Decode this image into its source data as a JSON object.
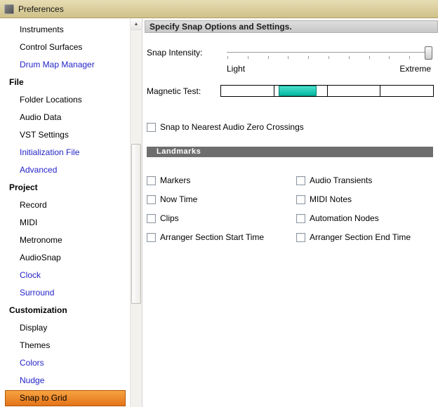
{
  "window": {
    "title": "Preferences"
  },
  "colors": {
    "titlebar-top": "#e7ddb4",
    "titlebar-bottom": "#cfc189",
    "accent-top": "#f7a341",
    "accent-bottom": "#e4731a",
    "accent-border": "#b25707",
    "link-blue": "#2424c8",
    "teal-top": "#4de0cc",
    "teal-bottom": "#00b7a2",
    "landmarks-gray": "#6e6e6e"
  },
  "sidebar": {
    "items": [
      {
        "label": "Instruments",
        "type": "child"
      },
      {
        "label": "Control Surfaces",
        "type": "child"
      },
      {
        "label": "Drum Map Manager",
        "type": "child",
        "color": "blue"
      },
      {
        "label": "File",
        "type": "header"
      },
      {
        "label": "Folder Locations",
        "type": "child"
      },
      {
        "label": "Audio Data",
        "type": "child"
      },
      {
        "label": "VST Settings",
        "type": "child"
      },
      {
        "label": "Initialization File",
        "type": "child",
        "color": "blue"
      },
      {
        "label": "Advanced",
        "type": "child",
        "color": "blue"
      },
      {
        "label": "Project",
        "type": "header"
      },
      {
        "label": "Record",
        "type": "child"
      },
      {
        "label": "MIDI",
        "type": "child"
      },
      {
        "label": "Metronome",
        "type": "child"
      },
      {
        "label": "AudioSnap",
        "type": "child"
      },
      {
        "label": "Clock",
        "type": "child",
        "color": "blue"
      },
      {
        "label": "Surround",
        "type": "child",
        "color": "blue"
      },
      {
        "label": "Customization",
        "type": "header"
      },
      {
        "label": "Display",
        "type": "child"
      },
      {
        "label": "Themes",
        "type": "child"
      },
      {
        "label": "Colors",
        "type": "child",
        "color": "blue"
      },
      {
        "label": "Nudge",
        "type": "child",
        "color": "blue"
      },
      {
        "label": "Snap to Grid",
        "type": "child",
        "selected": true
      }
    ]
  },
  "panel": {
    "header": "Specify Snap Options and Settings.",
    "snap_intensity": {
      "label": "Snap Intensity:",
      "min_label": "Light",
      "max_label": "Extreme",
      "value": "Extreme",
      "tick_count": 11
    },
    "magnetic_test": {
      "label": "Magnetic Test:",
      "segments": 4,
      "active_segment": 2
    },
    "zero_crossings": {
      "label": "Snap to Nearest Audio Zero Crossings",
      "checked": false
    },
    "landmarks": {
      "title": "Landmarks",
      "checkboxes": [
        {
          "label": "Markers",
          "checked": false
        },
        {
          "label": "Audio Transients",
          "checked": false
        },
        {
          "label": "Now Time",
          "checked": false
        },
        {
          "label": "MIDI Notes",
          "checked": false
        },
        {
          "label": "Clips",
          "checked": false
        },
        {
          "label": "Automation Nodes",
          "checked": false
        },
        {
          "label": "Arranger Section Start Time",
          "checked": false
        },
        {
          "label": "Arranger Section End Time",
          "checked": false
        }
      ]
    }
  }
}
